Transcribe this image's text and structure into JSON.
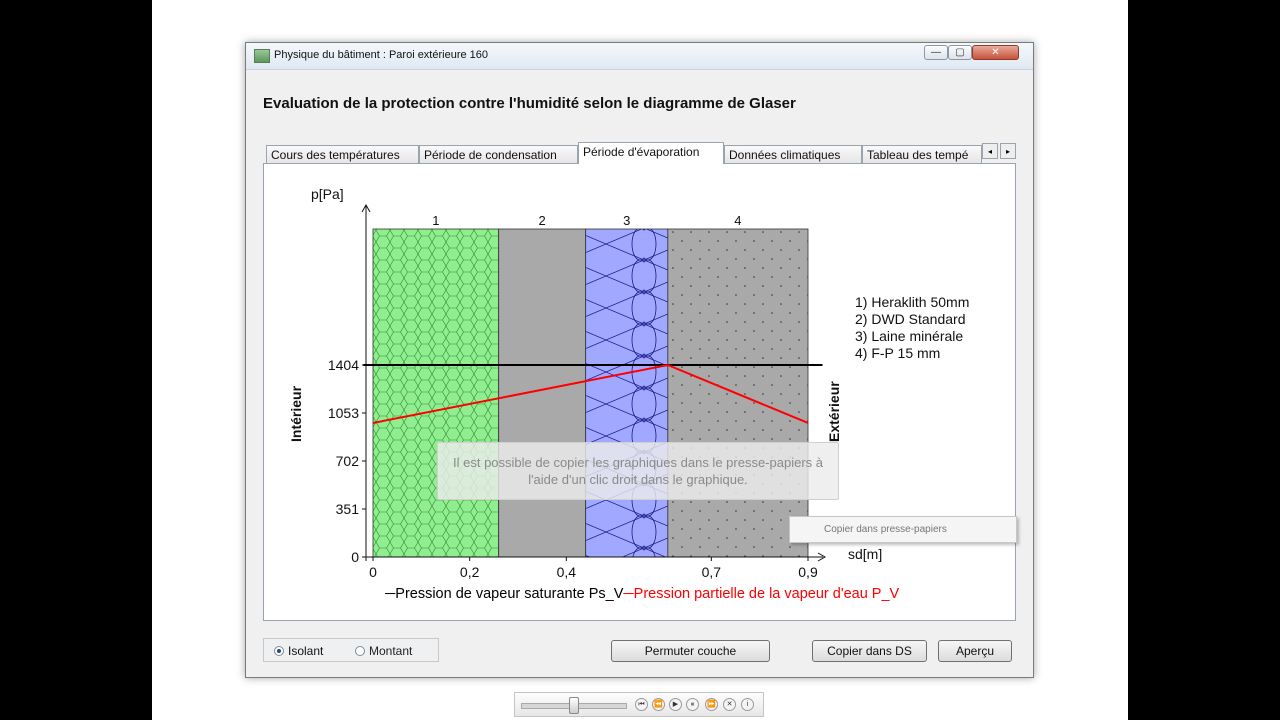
{
  "window": {
    "title": "Physique du bâtiment : Paroi extérieure 160",
    "min": "—",
    "max": "▢",
    "close": "✕"
  },
  "heading": "Evaluation de la protection contre l'humidité selon le diagramme de Glaser",
  "tabs": [
    {
      "label": "Cours des températures",
      "active": false
    },
    {
      "label": "Période de condensation",
      "active": false
    },
    {
      "label": "Période d'évaporation",
      "active": true
    },
    {
      "label": "Données climatiques",
      "active": false
    },
    {
      "label": "Tableau des tempé",
      "active": false
    }
  ],
  "tab_scroll": {
    "left": "◂",
    "right": "▸"
  },
  "chart_data": {
    "type": "line",
    "ylabel": "p[Pa]",
    "xlabel": "sd[m]",
    "left_label": "Intérieur",
    "right_label": "Extérieur",
    "xlim": [
      0,
      0.9
    ],
    "ylim": [
      0,
      1404
    ],
    "x_ticks": [
      "0",
      "0,2",
      "0,4",
      "0,7",
      "0,9"
    ],
    "x_tick_values": [
      0,
      0.2,
      0.4,
      0.7,
      0.9
    ],
    "y_ticks": [
      "0",
      "351",
      "702",
      "1053",
      "1404"
    ],
    "y_tick_values": [
      0,
      351,
      702,
      1053,
      1404
    ],
    "layers": [
      {
        "number": "1",
        "start": 0,
        "end": 0.26,
        "pattern": "hexagon",
        "color": "#90ee90"
      },
      {
        "number": "2",
        "start": 0.26,
        "end": 0.44,
        "pattern": "solid",
        "color": "#a9a9a9"
      },
      {
        "number": "3",
        "start": 0.44,
        "end": 0.61,
        "pattern": "insulation",
        "color": "#a0a8ff"
      },
      {
        "number": "4",
        "start": 0.61,
        "end": 0.9,
        "pattern": "dots",
        "color": "#a9a9a9"
      }
    ],
    "layer_legend": [
      "1) Heraklith 50mm",
      "2) DWD Standard",
      "3) Laine minérale",
      "4) F-P 15 mm"
    ],
    "series": [
      {
        "name": "Pression de vapeur saturante Ps_V",
        "color": "#000000",
        "points": [
          [
            -0.02,
            1404
          ],
          [
            0.93,
            1404
          ]
        ]
      },
      {
        "name": "Pression partielle de la vapeur d'eau P_V",
        "color": "#ff0000",
        "points": [
          [
            0,
            980
          ],
          [
            0.61,
            1404
          ],
          [
            0.9,
            980
          ]
        ]
      }
    ],
    "legend": [
      {
        "text": "─Pression de vapeur saturante Ps_V",
        "color": "#000000"
      },
      {
        "text": "─Pression partielle de la vapeur d'eau P_V",
        "color": "#ff0000"
      }
    ]
  },
  "tooltip": "Il est possible de copier les graphiques dans le presse-papiers à l'aide d'un clic droit dans le graphique.",
  "context_menu": {
    "item": "Copier dans presse-papiers"
  },
  "radios": [
    {
      "label": "Isolant",
      "checked": true
    },
    {
      "label": "Montant",
      "checked": false
    }
  ],
  "buttons": {
    "permuter": "Permuter couche",
    "copier": "Copier dans DS",
    "apercu": "Aperçu"
  },
  "media_buttons": [
    "⏮",
    "⏪",
    "▶",
    "⏸",
    "⏩",
    "✕",
    "i"
  ]
}
